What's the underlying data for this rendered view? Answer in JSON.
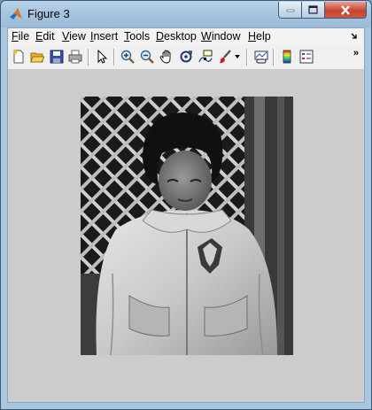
{
  "window": {
    "title": "Figure 3"
  },
  "menu": {
    "items": [
      {
        "label": "File",
        "accel": "F",
        "rest": "ile"
      },
      {
        "label": "Edit",
        "accel": "E",
        "rest": "dit"
      },
      {
        "label": "View",
        "accel": "V",
        "rest": "iew"
      },
      {
        "label": "Insert",
        "accel": "I",
        "rest": "nsert"
      },
      {
        "label": "Tools",
        "accel": "T",
        "rest": "ools"
      },
      {
        "label": "Desktop",
        "accel": "D",
        "rest": "esktop"
      },
      {
        "label": "Window",
        "accel": "W",
        "rest": "indow"
      },
      {
        "label": "Help",
        "accel": "H",
        "rest": "elp"
      }
    ],
    "overflow_icon": "dock-arrow-icon"
  },
  "toolbar": {
    "icons": [
      "new-figure-icon",
      "open-file-icon",
      "save-icon",
      "print-icon",
      "pointer-icon",
      "zoom-in-icon",
      "zoom-out-icon",
      "pan-icon",
      "rotate-3d-icon",
      "data-cursor-icon",
      "brush-icon",
      "brush-dropdown-icon",
      "link-plot-icon",
      "colorbar-icon",
      "legend-icon"
    ],
    "overflow": "»"
  },
  "figure": {
    "image": "grayscale-photo-of-child-in-jacket"
  },
  "colors": {
    "figure_background": "#cccccc",
    "titlebar": "#a6c4df",
    "close_button": "#c74530"
  }
}
